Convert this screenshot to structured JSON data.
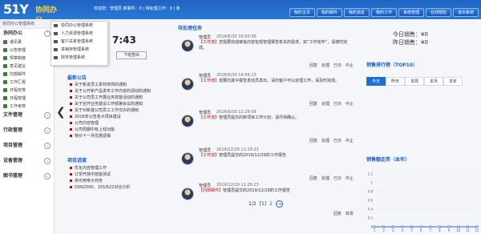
{
  "header": {
    "logo_number": "51Y",
    "logo_text": "协同办公",
    "welcome": "欢迎您：管理员 新邮件：0 | 待处理工作：0 | 条",
    "nav": [
      "我的主页",
      "我的邮件",
      "我的消息",
      "我的工作",
      "系统管理",
      "在线帮助",
      "退出系统"
    ]
  },
  "sidebar": {
    "title": "协同办公管理系统",
    "sections": [
      {
        "label": "协同办公",
        "items": [
          "通讯录",
          "公告管理",
          "规章制度",
          "意见建议",
          "内部邮件",
          "工作汇报",
          "日程安排",
          "日程管理",
          "工作考核"
        ]
      },
      {
        "label": "文件管理",
        "items": []
      },
      {
        "label": "行政管理",
        "items": []
      },
      {
        "label": "项目管理",
        "items": []
      },
      {
        "label": "设备管理",
        "items": []
      },
      {
        "label": "图书管理",
        "items": []
      }
    ],
    "collapse_arrow": "❮"
  },
  "popup_menu": [
    "协同办公管理系统",
    "人力资源管理系统",
    "客户关系管理系统",
    "进销存管理系统",
    "财务管理系统"
  ],
  "clock": {
    "time": "7:43",
    "button": "下班签出"
  },
  "announcements": {
    "title": "最新公告",
    "items": [
      "关于新进员工素材体例的通知",
      "关于公开新产品发布工作内容的调动的通知",
      "关于公司员工开展业务技能活动的通知",
      "关于召开业务建设工作部署会议的通知",
      "关于对新建公司员工工作交办的通知",
      "2016年公告各大项目建设",
      "公司内容管理",
      "公司周期中有上线功能",
      "特价十一月优惠促销"
    ]
  },
  "projects": {
    "title": "项目进度",
    "items": [
      "优化内容管理工作",
      "订票开放中技能测试",
      "高可用电子商务",
      "OSN2500、155/622对比分析"
    ]
  },
  "tasks": {
    "title": "待处理任务",
    "items": [
      {
        "name": "管理员",
        "time": "2016/6/30 16:50:56",
        "tag": "【工作流】",
        "text": "您需要完成审批内容包括管理报告有关的需求，如“工作完毕”，请按时完成。",
        "actions": [
          "回复",
          "处理",
          "已办",
          "中止"
        ]
      },
      {
        "name": "管理员",
        "time": "2016/6/30 14:56:13",
        "tag": "【工作流】",
        "text": "需要向其中报告发动员发出，请向客户可以处理工作，请及时完成。",
        "actions": [
          "回复",
          "处理",
          "已办",
          "中止"
        ]
      },
      {
        "name": "管理员",
        "time": "2016/6/30 12:29:09",
        "tag": "【工作流】",
        "text": "管理员提交的新项目工作计划，请尽快确认。",
        "actions": [
          "回复",
          "处理",
          "已办",
          "中止"
        ]
      },
      {
        "name": "管理员",
        "time": "2019/12/29 11:29:23",
        "tag": "【工作流】",
        "text": "管理员提交的2019/12/29的工作报告",
        "actions": [
          "回复",
          "处理",
          "已办",
          "中止"
        ]
      },
      {
        "name": "管理员",
        "time": "2019/12/29 11:29:23",
        "tag": "【内部邮件】",
        "text": "管理员提交的2019/12/29的工作报告",
        "actions": [
          "回复",
          "转发"
        ]
      }
    ],
    "pager": {
      "info": "1/2",
      "current": "[1]",
      "next_page": "2",
      "next": "→"
    }
  },
  "sales": {
    "today": "今日销售：¥0",
    "yesterday": "昨日销售：¥0"
  },
  "ranking": {
    "title": "销售排行榜（TOP10）",
    "tabs": [
      "今天",
      "昨天",
      "本周",
      "本月",
      "本年"
    ],
    "active": 0
  },
  "trend": {
    "title": "销售额走势（本年）"
  },
  "chart_data": {
    "type": "line",
    "title": "销售额走势（本年）",
    "x": [
      1,
      2,
      3,
      4,
      5,
      6,
      7,
      8,
      9,
      10,
      11,
      12
    ],
    "y_ticks": [
      0,
      0.2,
      0.4,
      0.6,
      0.8,
      1.0,
      1.2
    ],
    "series": [
      {
        "values": [
          0,
          0,
          0,
          0,
          0,
          0,
          0,
          0,
          0,
          0,
          0,
          0
        ]
      }
    ],
    "ylim": [
      0,
      1.2
    ],
    "color": "#1f6fd8"
  }
}
